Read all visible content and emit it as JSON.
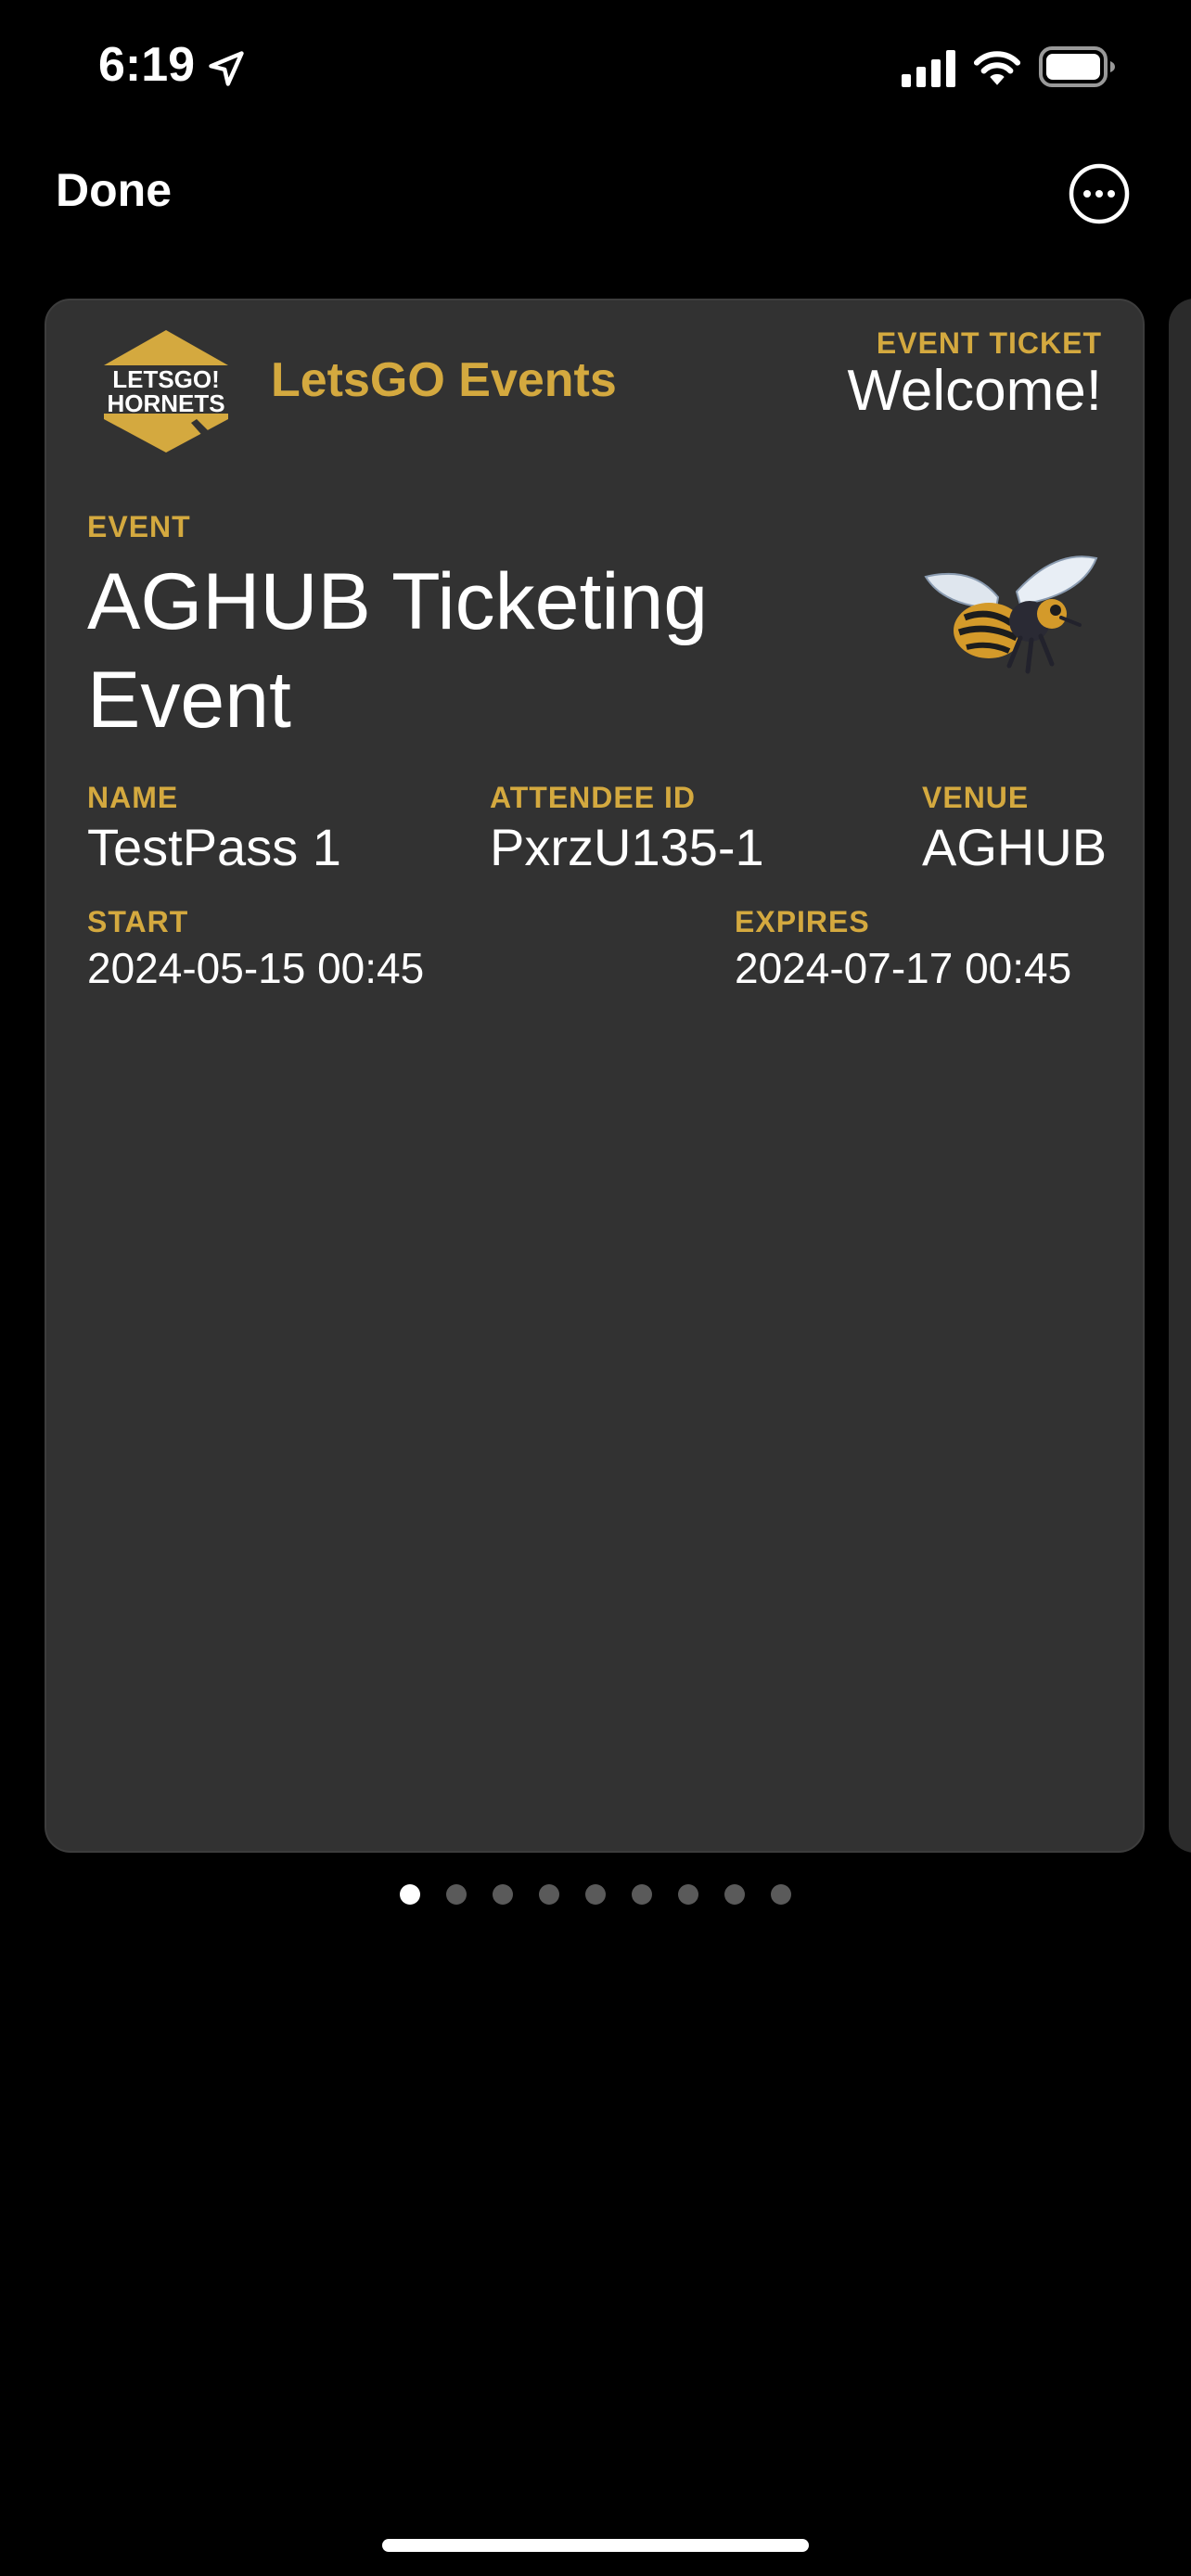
{
  "status_bar": {
    "time": "6:19"
  },
  "nav": {
    "done_label": "Done"
  },
  "pass": {
    "logo_text_line1": "LETSGO!",
    "logo_text_line2": "HORNETS",
    "organization": "LetsGO Events",
    "header_label": "EVENT TICKET",
    "header_value": "Welcome!",
    "event_label": "EVENT",
    "event_value": "AGHUB Ticketing Event",
    "fields": {
      "name_label": "NAME",
      "name_value": "TestPass 1",
      "attendee_label": "ATTENDEE ID",
      "attendee_value": "PxrzU135-1",
      "venue_label": "VENUE",
      "venue_value": "AGHUB",
      "start_label": "START",
      "start_value": "2024-05-15 00:45",
      "expires_label": "EXPIRES",
      "expires_value": "2024-07-17 00:45"
    },
    "colors": {
      "card_background": "#323232",
      "label_gold": "#d4a93f"
    }
  },
  "pagination": {
    "total": 9,
    "current": 1
  },
  "icons": [
    "location-arrow-icon",
    "cellular-signal-icon",
    "wifi-icon",
    "battery-icon",
    "more-ellipsis-icon",
    "hornets-logo",
    "hornet-mascot-image"
  ]
}
